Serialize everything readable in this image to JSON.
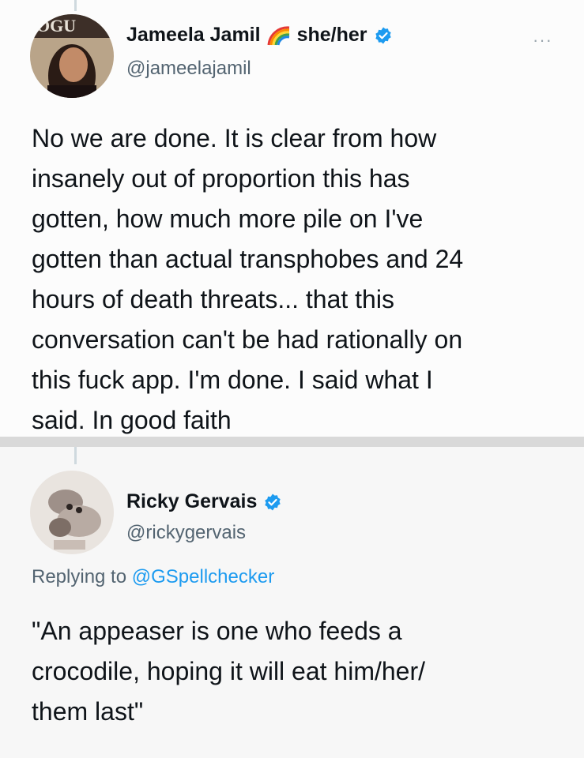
{
  "tweets": [
    {
      "display_name": "Jameela Jamil",
      "emoji_icon": "rainbow-icon",
      "pronouns": "she/her",
      "verified_icon": "verified-badge-icon",
      "handle": "@jameelajamil",
      "more_icon": "more-options-icon",
      "more_label": "···",
      "text": "No we are done. It is clear from how\ninsanely out of proportion this has\ngotten, how much more pile on I've\ngotten than actual transphobes and 24\nhours of death threats... that this\nconversation can't be had rationally on\nthis fuck app. I'm done. I said what I\nsaid. In good faith"
    },
    {
      "display_name": "Ricky Gervais",
      "verified_icon": "verified-badge-icon",
      "handle": "@rickygervais",
      "replying_prefix": "Replying to ",
      "replying_to": "@GSpellchecker",
      "text": "\"An appeaser is one who feeds a\ncrocodile, hoping it will eat him/her/\nthem last\""
    }
  ],
  "colors": {
    "name": "#0f1419",
    "handle": "#536471",
    "link": "#1d9bf0",
    "verified": "#1d9bf0",
    "background": "#ffffff",
    "separator": "#d9d9d9"
  }
}
